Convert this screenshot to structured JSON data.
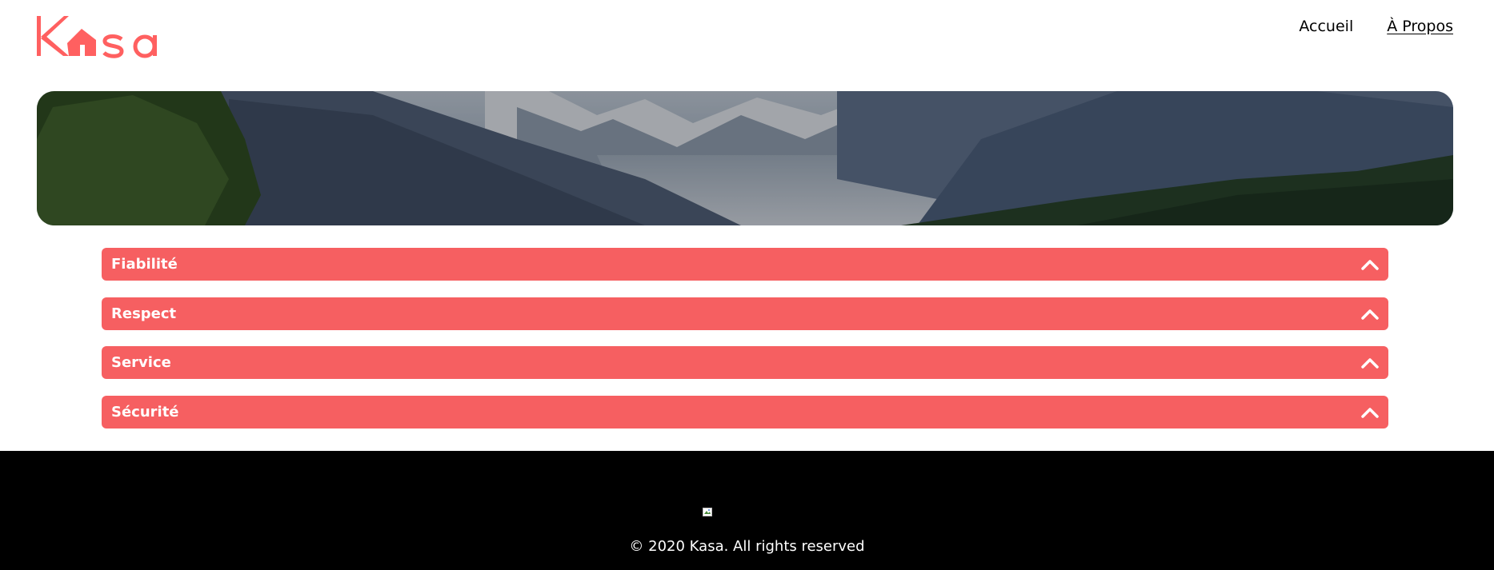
{
  "brand": {
    "name": "Kasa",
    "color": "#FF6060"
  },
  "nav": {
    "items": [
      {
        "label": "Accueil",
        "active": false
      },
      {
        "label": "À Propos",
        "active": true
      }
    ]
  },
  "banner": {
    "description": "mountain-landscape-banner"
  },
  "accordions": [
    {
      "label": "Fiabilité",
      "icon": "chevron-up-icon"
    },
    {
      "label": "Respect",
      "icon": "chevron-up-icon"
    },
    {
      "label": "Service",
      "icon": "chevron-up-icon"
    },
    {
      "label": "Sécurité",
      "icon": "chevron-up-icon"
    }
  ],
  "footer": {
    "copyright": "© 2020 Kasa. All rights reserved",
    "logo_icon": "broken-image-icon"
  },
  "colors": {
    "accent": "#FF6060",
    "footer_bg": "#000000"
  }
}
